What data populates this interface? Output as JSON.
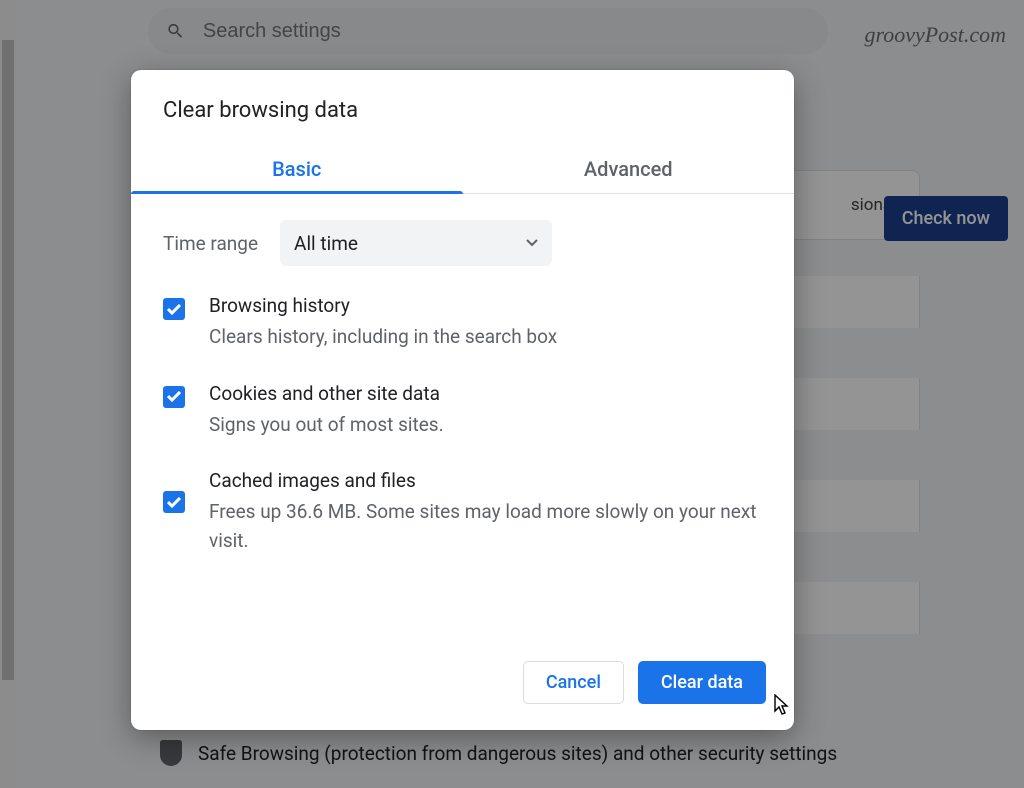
{
  "search": {
    "placeholder": "Search settings"
  },
  "watermark": "groovyPost.com",
  "background": {
    "extensions_text": "sions,",
    "check_now": "Check now",
    "safe_browsing": "Safe Browsing (protection from dangerous sites) and other security settings"
  },
  "dialog": {
    "title": "Clear browsing data",
    "tabs": {
      "basic": "Basic",
      "advanced": "Advanced"
    },
    "time_range": {
      "label": "Time range",
      "value": "All time"
    },
    "options": [
      {
        "title": "Browsing history",
        "desc": "Clears history, including in the search box",
        "checked": true
      },
      {
        "title": "Cookies and other site data",
        "desc": "Signs you out of most sites.",
        "checked": true
      },
      {
        "title": "Cached images and files",
        "desc": "Frees up 36.6 MB. Some sites may load more slowly on your next visit.",
        "checked": true
      }
    ],
    "actions": {
      "cancel": "Cancel",
      "confirm": "Clear data"
    }
  }
}
